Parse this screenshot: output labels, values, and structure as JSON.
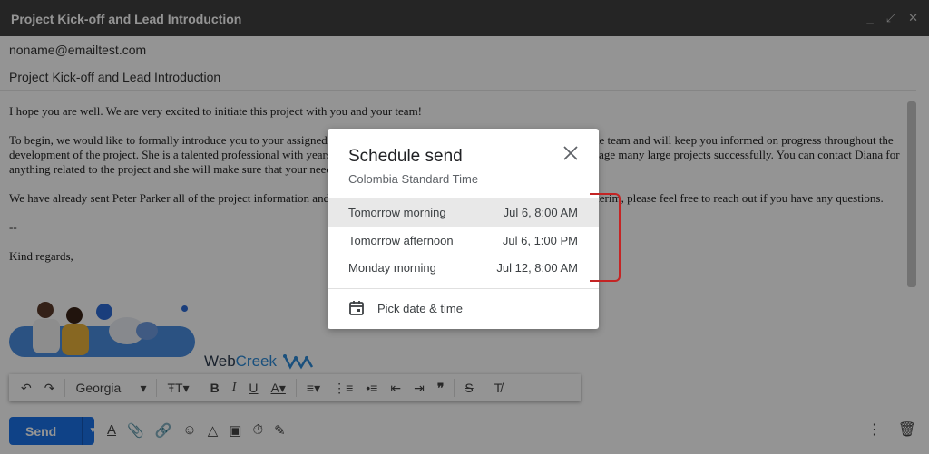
{
  "window": {
    "title": "Project Kick-off and Lead Introduction",
    "controls": [
      "_",
      "⤢",
      "✕"
    ]
  },
  "compose": {
    "to": "noname@emailtest.com",
    "subject": "Project Kick-off and Lead Introduction",
    "body": [
      "I hope you are well. We are very excited to initiate this project with you and your team!",
      "To begin, we would like to formally introduce you to your assigned project lead, Diana. She will be in charge of managing the team and will keep you informed on progress throughout the development of the project. She is a talented professional with years of experience in this area and this has helped her to manage many large projects successfully. You can contact Diana for anything related to the project and she will make sure that your needs are covered.",
      "We have already sent Peter Parker all of the project information and we expect to have the first report by tomorrow. In the interim, please feel free to reach out if you have any questions.",
      "--",
      "Kind regards,"
    ]
  },
  "signature": {
    "brand_part1": "Web",
    "brand_part2": "Creek"
  },
  "format_toolbar": {
    "font": "Georgia",
    "icons": [
      "undo-icon",
      "redo-icon",
      "font-size-icon",
      "bold-icon",
      "italic-icon",
      "underline-icon",
      "text-color-icon",
      "align-icon",
      "numbered-list-icon",
      "bulleted-list-icon",
      "indent-less-icon",
      "indent-more-icon",
      "quote-icon",
      "strikethrough-icon",
      "remove-formatting-icon"
    ]
  },
  "bottom_bar": {
    "send_label": "Send",
    "icons": [
      "formatting-icon",
      "attach-icon",
      "link-icon",
      "emoji-icon",
      "drive-icon",
      "photo-icon",
      "confidential-icon",
      "signature-icon"
    ],
    "right_icons": [
      "more-options-icon",
      "discard-icon"
    ]
  },
  "schedule_dialog": {
    "title": "Schedule send",
    "timezone": "Colombia Standard Time",
    "options": [
      {
        "name": "Tomorrow morning",
        "time": "Jul 6, 8:00 AM"
      },
      {
        "name": "Tomorrow afternoon",
        "time": "Jul 6, 1:00 PM"
      },
      {
        "name": "Monday morning",
        "time": "Jul 12, 8:00 AM"
      }
    ],
    "pick_label": "Pick date & time"
  },
  "colors": {
    "accent": "#1a73e8",
    "annotation": "#c42424",
    "titlebar": "#404040"
  }
}
